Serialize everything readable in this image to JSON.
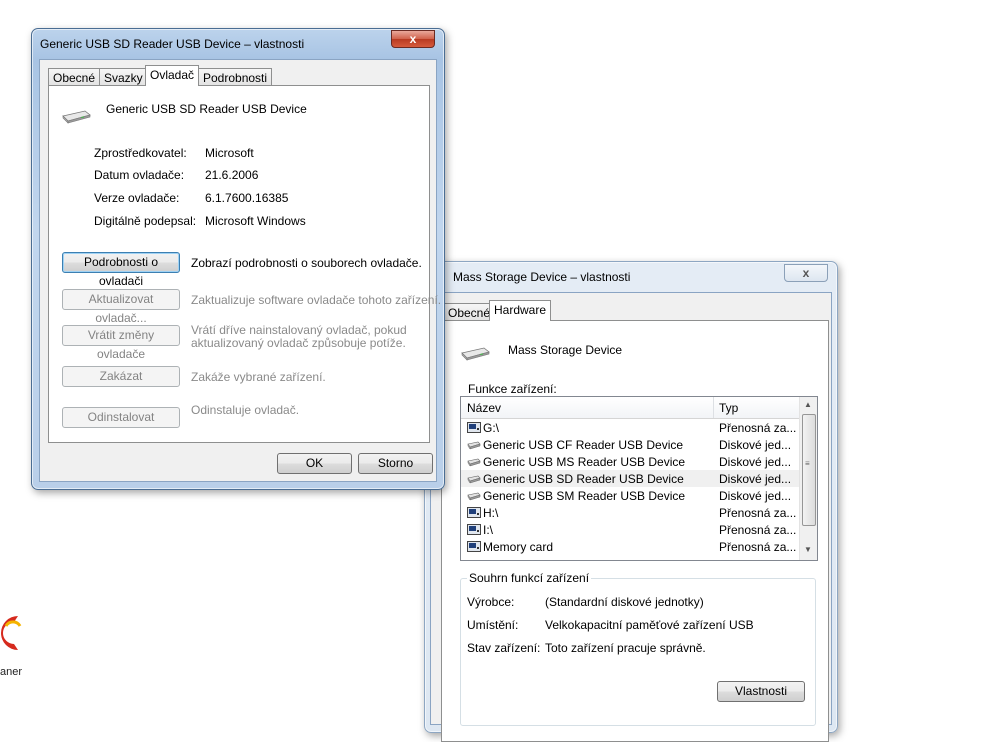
{
  "window1": {
    "title": "Generic USB SD Reader USB Device – vlastnosti",
    "close_label": "x",
    "tabs": [
      "Obecné",
      "Svazky",
      "Ovladač",
      "Podrobnosti"
    ],
    "device_name": "Generic USB SD Reader USB Device",
    "properties": [
      {
        "label": "Zprostředkovatel:",
        "value": "Microsoft"
      },
      {
        "label": "Datum ovladače:",
        "value": "21.6.2006"
      },
      {
        "label": "Verze ovladače:",
        "value": "6.1.7600.16385"
      },
      {
        "label": "Digitálně podepsal:",
        "value": "Microsoft Windows"
      }
    ],
    "actions": [
      {
        "label": "Podrobnosti o ovladači",
        "description": "Zobrazí podrobnosti o souborech ovladače."
      },
      {
        "label": "Aktualizovat ovladač...",
        "description": "Zaktualizuje software ovladače tohoto zařízení."
      },
      {
        "label": "Vrátit změny ovladače",
        "description_line1": "Vrátí dříve nainstalovaný ovladač, pokud",
        "description_line2": "aktualizovaný ovladač způsobuje potíže."
      },
      {
        "label": "Zakázat",
        "description": "Zakáže vybrané zařízení."
      },
      {
        "label": "Odinstalovat",
        "description": "Odinstaluje ovladač."
      }
    ],
    "ok_label": "OK",
    "cancel_label": "Storno"
  },
  "window2": {
    "title": "Mass Storage Device – vlastnosti",
    "close_label": "x",
    "tabs": [
      "Obecné",
      "Hardware"
    ],
    "device_name": "Mass Storage Device",
    "functions_label": "Funkce zařízení:",
    "columns": [
      "Název",
      "Typ"
    ],
    "rows": [
      {
        "name": "G:\\",
        "type": "Přenosná za...",
        "icon": "removable-disk-icon"
      },
      {
        "name": "Generic USB CF Reader USB Device",
        "type": "Diskové jed...",
        "icon": "disk-drive-icon"
      },
      {
        "name": "Generic USB MS Reader USB Device",
        "type": "Diskové jed...",
        "icon": "disk-drive-icon"
      },
      {
        "name": "Generic USB SD Reader USB Device",
        "type": "Diskové jed...",
        "icon": "disk-drive-icon"
      },
      {
        "name": "Generic USB SM Reader USB Device",
        "type": "Diskové jed...",
        "icon": "disk-drive-icon"
      },
      {
        "name": "H:\\",
        "type": "Přenosná za...",
        "icon": "removable-disk-icon"
      },
      {
        "name": "I:\\",
        "type": "Přenosná za...",
        "icon": "removable-disk-icon"
      },
      {
        "name": "Memory card",
        "type": "Přenosná za...",
        "icon": "removable-disk-icon"
      }
    ],
    "summary_label": "Souhrn funkcí zařízení",
    "summary": [
      {
        "label": "Výrobce:",
        "value": "(Standardní diskové jednotky)"
      },
      {
        "label": "Umístění:",
        "value": "Velkokapacitní paměťové zařízení USB"
      },
      {
        "label": "Stav zařízení:",
        "value": "Toto zařízení pracuje správně."
      }
    ],
    "properties_button": "Vlastnosti"
  },
  "desktop": {
    "icon_label": "aner"
  }
}
